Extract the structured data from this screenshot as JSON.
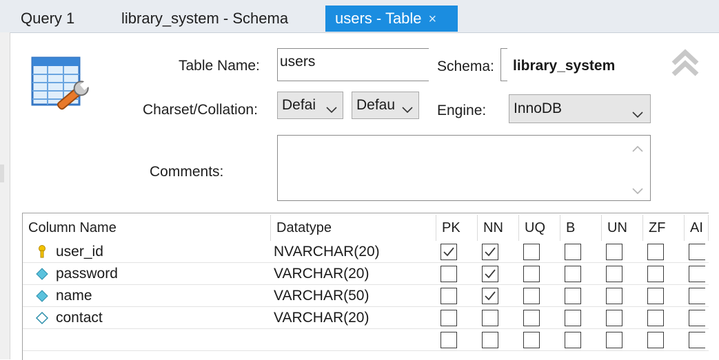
{
  "tabs": [
    {
      "label": "Query 1"
    },
    {
      "label": "library_system - Schema"
    },
    {
      "label": "users - Table",
      "close": "×"
    }
  ],
  "form": {
    "table_name_label": "Table Name:",
    "table_name_value": "users",
    "schema_label": "Schema:",
    "schema_value": "library_system",
    "charset_label": "Charset/Collation:",
    "charset_value": "Defai",
    "collation_value": "Defau",
    "engine_label": "Engine:",
    "engine_value": "InnoDB",
    "comments_label": "Comments:",
    "comments_value": ""
  },
  "grid": {
    "headers": [
      "Column Name",
      "Datatype",
      "PK",
      "NN",
      "UQ",
      "B",
      "UN",
      "ZF",
      "AI"
    ],
    "rows": [
      {
        "name": "user_id",
        "type": "NVARCHAR(20)",
        "icon": "key-icon",
        "flags": [
          true,
          true,
          false,
          false,
          false,
          false,
          false
        ]
      },
      {
        "name": "password",
        "type": "VARCHAR(20)",
        "icon": "column-filled-diamond-icon",
        "flags": [
          false,
          true,
          false,
          false,
          false,
          false,
          false
        ]
      },
      {
        "name": "name",
        "type": "VARCHAR(50)",
        "icon": "column-filled-diamond-icon",
        "flags": [
          false,
          true,
          false,
          false,
          false,
          false,
          false
        ]
      },
      {
        "name": "contact",
        "type": "VARCHAR(20)",
        "icon": "column-hollow-diamond-icon",
        "flags": [
          false,
          false,
          false,
          false,
          false,
          false,
          false
        ]
      },
      {
        "name": "",
        "type": "",
        "icon": "",
        "flags": [
          false,
          false,
          false,
          false,
          false,
          false,
          false
        ]
      }
    ]
  },
  "colors": {
    "accent": "#1b8de0",
    "key": "#f2c200",
    "diamond": "#5bc2dd"
  }
}
